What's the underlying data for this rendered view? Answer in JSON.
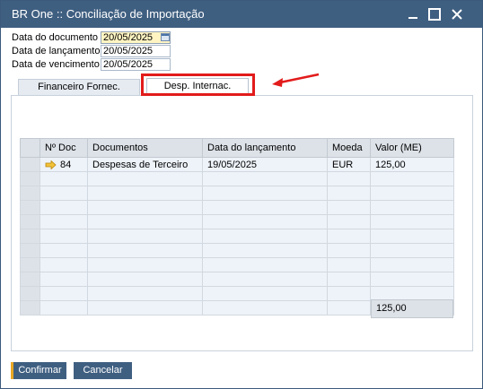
{
  "window": {
    "title": "BR One :: Conciliação de Importação"
  },
  "fields": [
    {
      "label": "Data do documento",
      "value": "20/05/2025"
    },
    {
      "label": "Data de lançamento",
      "value": "20/05/2025"
    },
    {
      "label": "Data de vencimento",
      "value": "20/05/2025"
    }
  ],
  "tabs": [
    {
      "label": "Financeiro Fornec."
    },
    {
      "label": "Desp. Internac."
    }
  ],
  "grid": {
    "columns": [
      "",
      "Nº Doc",
      "Documentos",
      "Data do lançamento",
      "Moeda",
      "Valor (ME)"
    ],
    "rows": [
      {
        "doc": "84",
        "documento": "Despesas de Terceiro",
        "data": "19/05/2025",
        "moeda": "EUR",
        "valor": "125,00"
      }
    ],
    "total": "125,00"
  },
  "buttons": {
    "confirm": "Confirmar",
    "cancel": "Cancelar"
  },
  "colors": {
    "titlebar": "#3f5f81",
    "highlight": "#e21b1b",
    "focus_field": "#fff4c2",
    "confirm_accent": "#e9a825"
  }
}
